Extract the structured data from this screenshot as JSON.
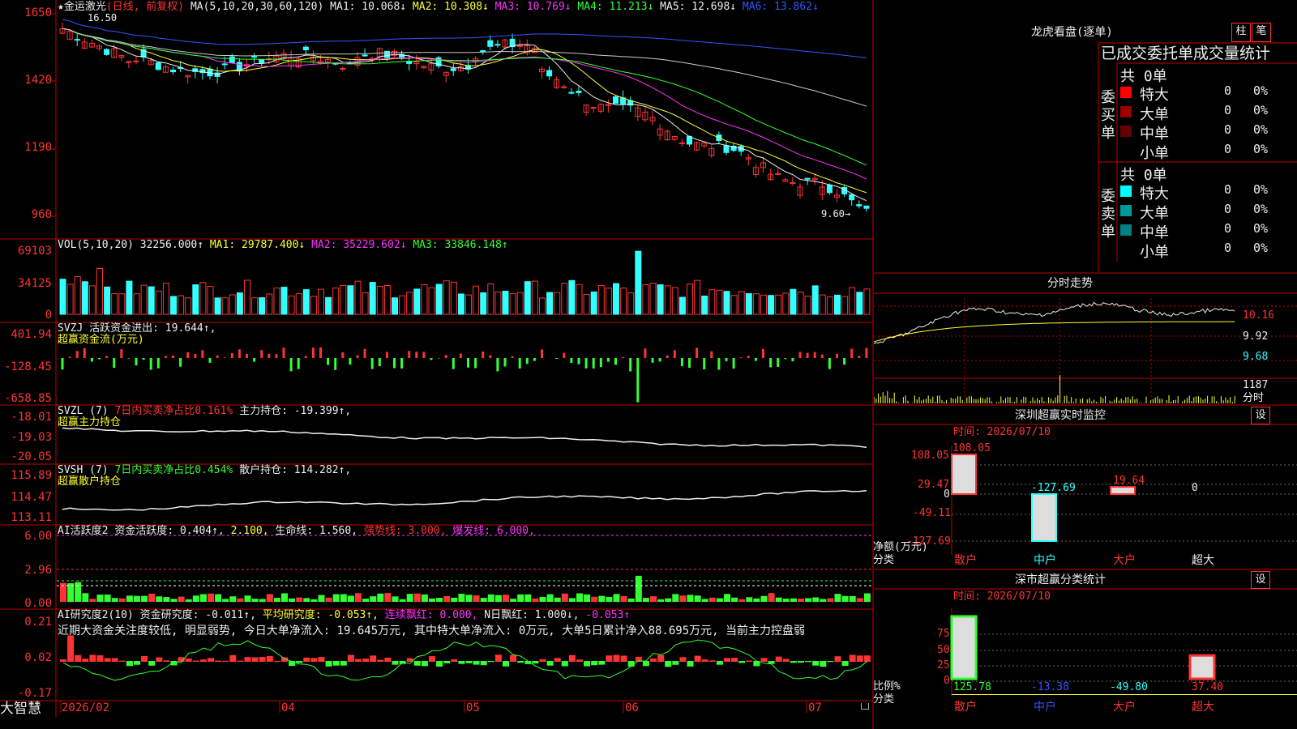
{
  "app": {
    "name": "大智慧"
  },
  "main_chart": {
    "stock_name": "★金运激光",
    "period": "(日线, 前复权)",
    "ma_label": "MA(5,10,20,30,60,120)",
    "ma": [
      {
        "label": "MA1: 10.068↓",
        "color": "#eeeeee"
      },
      {
        "label": "MA2: 10.308↓",
        "color": "#ffff33"
      },
      {
        "label": "MA3: 10.769↓",
        "color": "#ff33ff"
      },
      {
        "label": "MA4: 11.213↓",
        "color": "#33ff33"
      },
      {
        "label": "MA5: 12.698↓",
        "color": "#cccccc"
      },
      {
        "label": "MA6: 13.862↓",
        "color": "#3355ff"
      }
    ],
    "high_mark": "16.50",
    "low_mark": "9.60→",
    "yticks": [
      "1650",
      "1420",
      "1190",
      "960"
    ]
  },
  "vol": {
    "title": "VOL(5,10,20)",
    "value": "32256.000↑",
    "ma1": "MA1: 29787.400↓",
    "ma2": "MA2: 35229.602↓",
    "ma3": "MA3: 33846.148↑",
    "yticks": [
      "69103",
      "34125",
      "0"
    ]
  },
  "svzj": {
    "title": "SVZJ",
    "label": "活跃资金进出: 19.644↑,",
    "sub": "超赢资金流(万元)",
    "yticks": [
      "401.94",
      "-128.45",
      "-658.85"
    ]
  },
  "svzl": {
    "title": "SVZL (7)",
    "label": "7日内买卖净占比0.161%",
    "label2": "主力持仓: -19.399↑,",
    "sub": "超赢主力持仓",
    "yticks": [
      "-18.01",
      "-19.03",
      "-20.05"
    ]
  },
  "svsh": {
    "title": "SVSH (7)",
    "label": "7日内买卖净占比0.454%",
    "label2": "散户持仓: 114.282↑,",
    "sub": "超赢散户持仓",
    "yticks": [
      "115.89",
      "114.47",
      "113.11"
    ]
  },
  "ai_active": {
    "title": "AI活跃度2",
    "l1": "资金活跃度: 0.404↑,",
    "l2": "2.100,",
    "l3": "生命线: 1.560,",
    "l4": "强势线: 3.000,",
    "l5": "爆发线: 6.000,",
    "yticks": [
      "6.00",
      "2.96",
      "0.00"
    ]
  },
  "ai_research": {
    "title": "AI研究度2(10)",
    "l1": "资金研究度: -0.011↑,",
    "l2": "平均研究度: -0.053↑,",
    "l3": "连续飘红: 0.000,",
    "l4": "N日飘红: 1.000↓,",
    "l5": "-0.053↑",
    "summary": "近期大资金关注度较低, 明显弱势, 今日大单净流入: 19.645万元, 其中特大单净流入: 0万元, 大单5日累计净入88.695万元, 当前主力控盘弱",
    "yticks": [
      "0.21",
      "0.02",
      "-0.17"
    ]
  },
  "xaxis": [
    "2026/02",
    "04",
    "05",
    "06",
    "07"
  ],
  "right": {
    "dragon_title": "龙虎看盘(逐单)",
    "btn1": "柱",
    "btn2": "笔",
    "tabs_line": "已成交委托单成交量统计",
    "buy": {
      "side": "委买单",
      "total": "共 0单",
      "rows": [
        {
          "label": "特大",
          "count": "0",
          "pct": "0%",
          "color": "#ff0000"
        },
        {
          "label": "大单",
          "count": "0",
          "pct": "0%",
          "color": "#990000"
        },
        {
          "label": "中单",
          "count": "0",
          "pct": "0%",
          "color": "#660000"
        },
        {
          "label": "小单",
          "count": "0",
          "pct": "0%",
          "color": "#000000"
        }
      ]
    },
    "sell": {
      "side": "委卖单",
      "total": "共 0单",
      "rows": [
        {
          "label": "特大",
          "count": "0",
          "pct": "0%",
          "color": "#00ffff"
        },
        {
          "label": "大单",
          "count": "0",
          "pct": "0%",
          "color": "#009999"
        },
        {
          "label": "中单",
          "count": "0",
          "pct": "0%",
          "color": "#008080"
        },
        {
          "label": "小单",
          "count": "0",
          "pct": "0%",
          "color": "#000000"
        }
      ]
    },
    "fenshi_title": "分时走势",
    "fenshi_prices": [
      "10.16",
      "9.92",
      "9.68"
    ],
    "fenshi_vol": "1187",
    "fenshi_vol_label": "分时",
    "sz_monitor_title": "深圳超赢实时监控",
    "settings_btn": "设",
    "sz_time": "时间: 2026/07/10",
    "sz_yticks": [
      "108.05",
      "29.47",
      "0",
      "-49.11",
      "-127.69"
    ],
    "sz_bar_labels": [
      "108.05",
      "-127.69",
      "19.64",
      "0"
    ],
    "sz_left_labels": [
      "净额(万元)",
      "分类"
    ],
    "categories": [
      "散户",
      "中户",
      "大户",
      "超大"
    ],
    "sz_class_title": "深市超赢分类统计",
    "cls_time": "时间: 2026/07/10",
    "cls_yticks": [
      "75",
      "50",
      "25",
      "0"
    ],
    "cls_left_labels": [
      "比例%",
      "分类"
    ],
    "cls_values": [
      "125.78",
      "-13.38",
      "-49.80",
      "37.40"
    ]
  }
}
